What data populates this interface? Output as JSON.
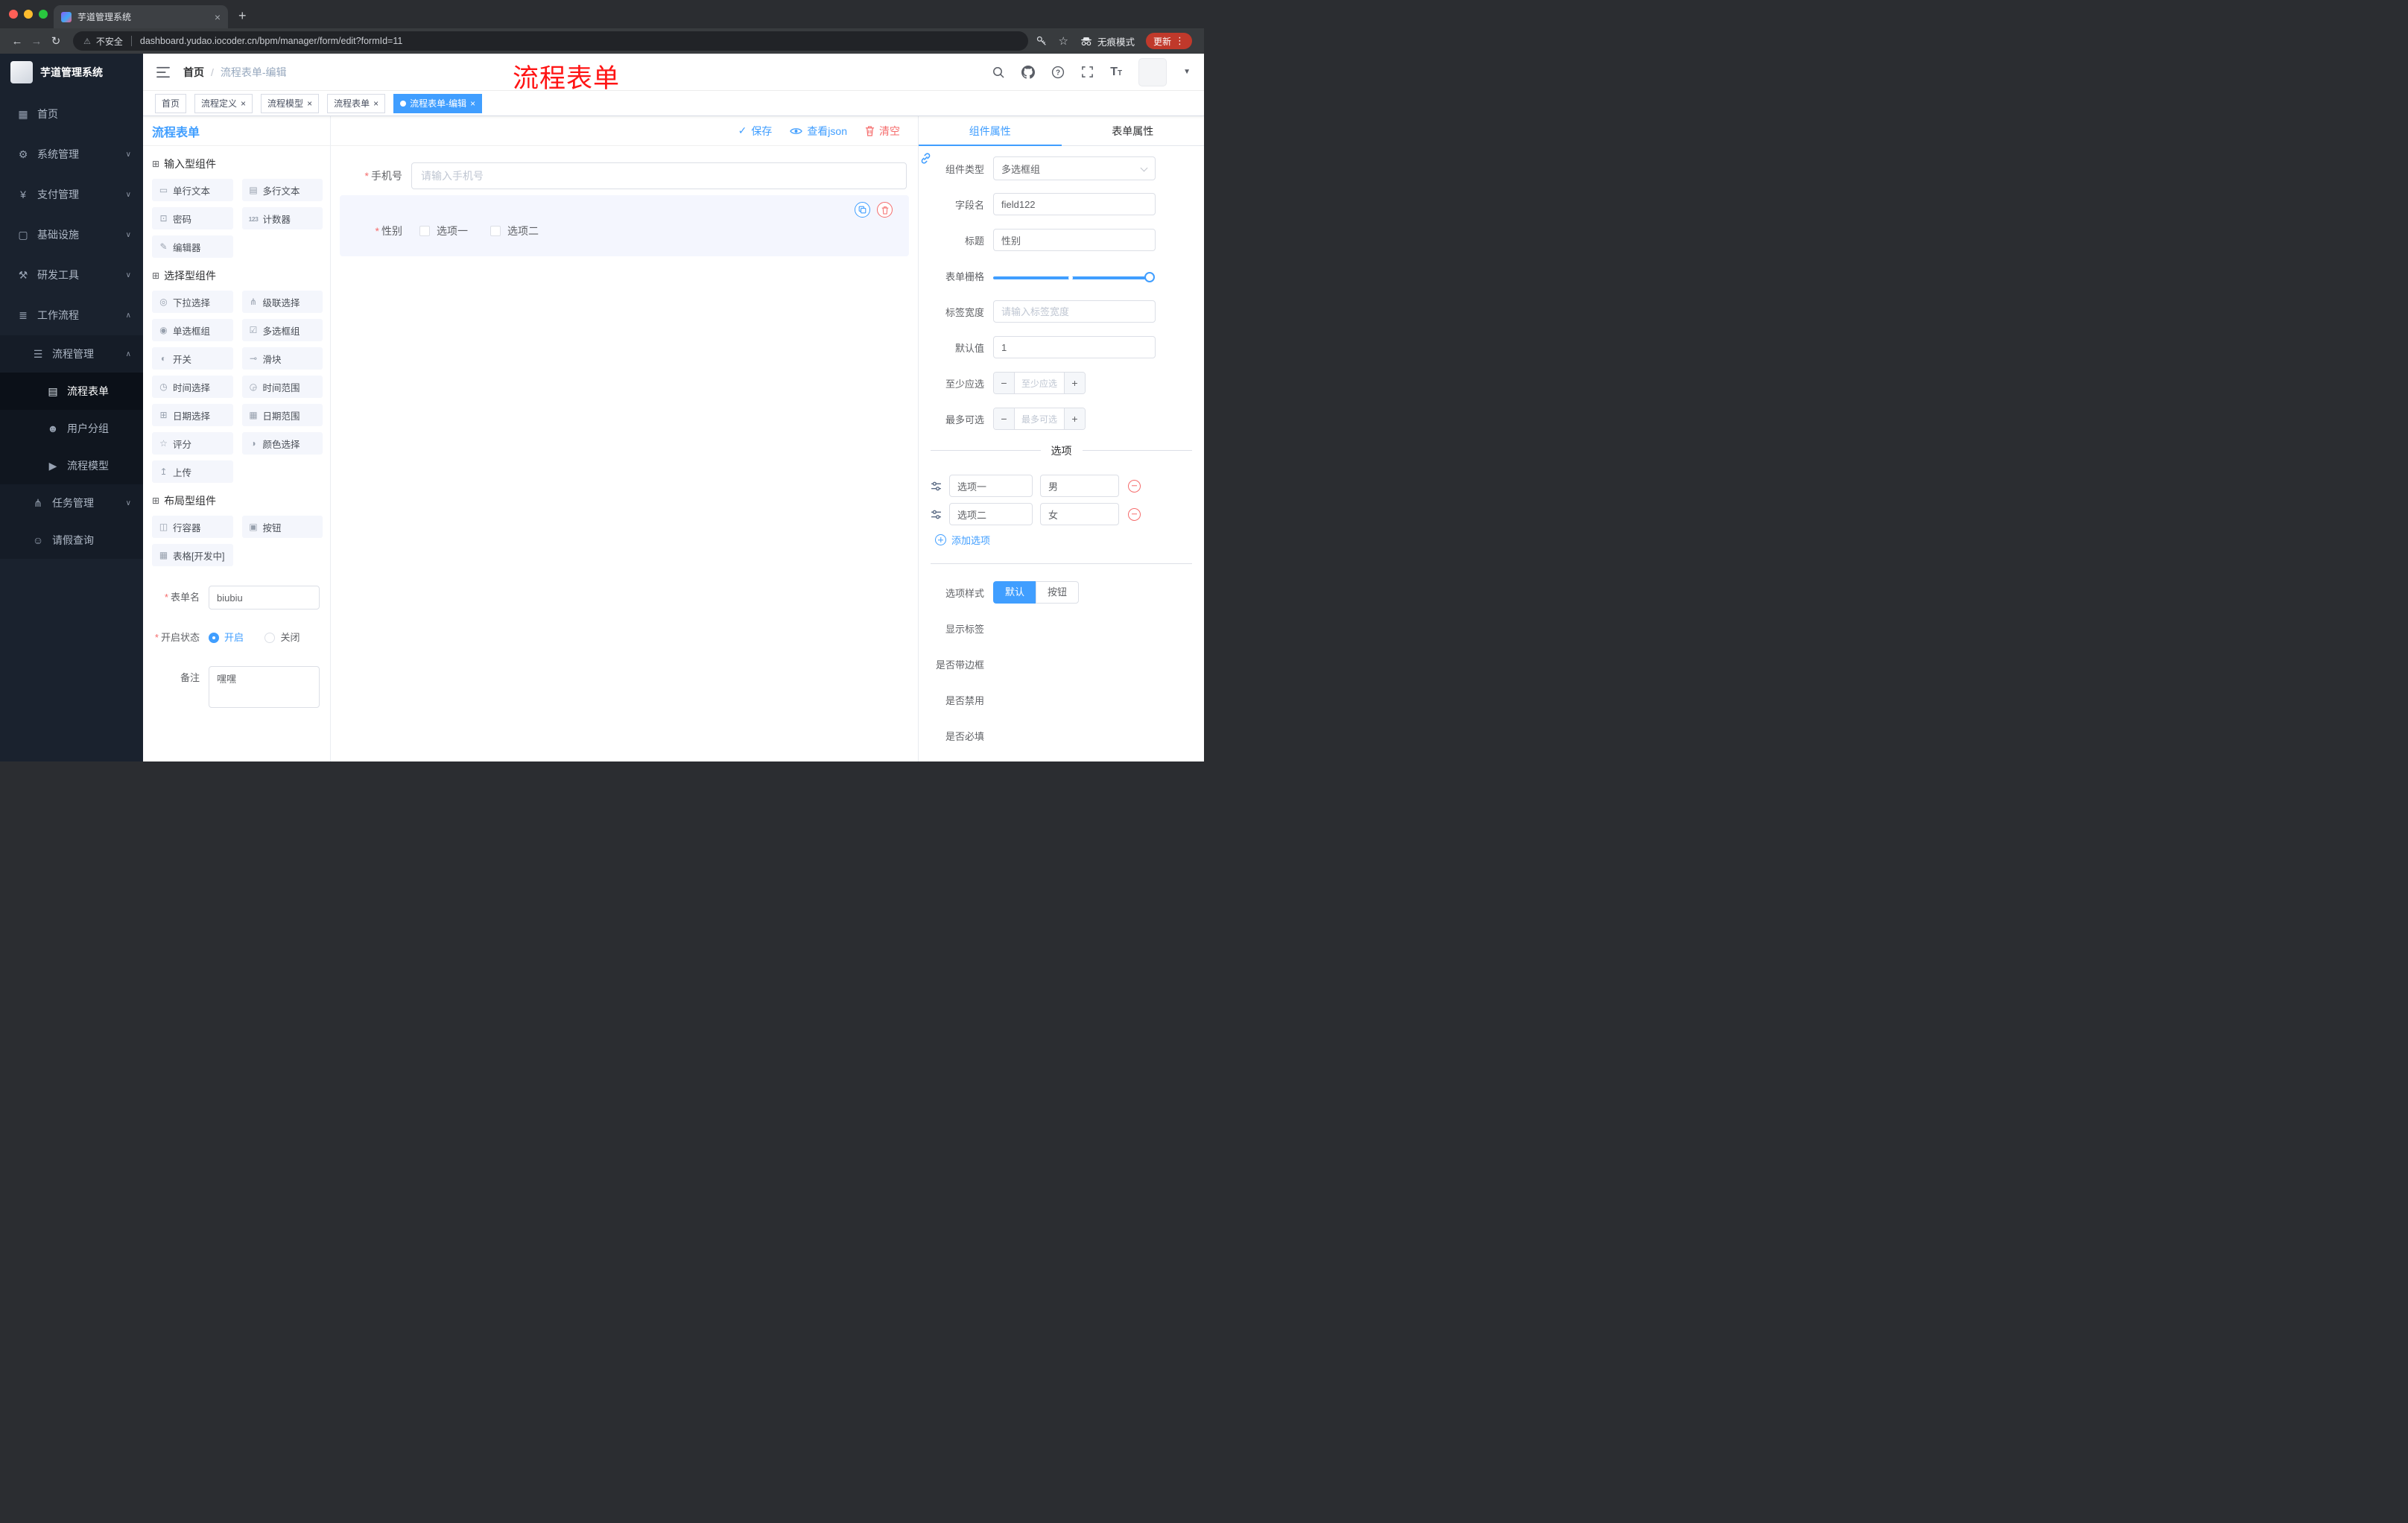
{
  "annotation": {
    "text": "流程表单"
  },
  "colors": {
    "primary": "#409EFF",
    "danger": "#F56C6C",
    "annotation_red": "#FF1414",
    "sidebar_bg": "#1A222E"
  },
  "browser": {
    "tab_title": "芋道管理系统",
    "security_label": "不安全",
    "url": "dashboard.yudao.iocoder.cn/bpm/manager/form/edit?formId=11",
    "incognito_label": "无痕模式",
    "update_label": "更新"
  },
  "sidebar": {
    "logo_title": "芋道管理系统",
    "items": [
      {
        "label": "首页",
        "icon": "dashboard-icon",
        "level": 1
      },
      {
        "label": "系统管理",
        "icon": "gear-icon",
        "level": 1,
        "chevron": "down"
      },
      {
        "label": "支付管理",
        "icon": "payment-icon",
        "level": 1,
        "chevron": "down"
      },
      {
        "label": "基础设施",
        "icon": "infrastructure-icon",
        "level": 1,
        "chevron": "down"
      },
      {
        "label": "研发工具",
        "icon": "dev-tools-icon",
        "level": 1,
        "chevron": "down"
      },
      {
        "label": "工作流程",
        "icon": "workflow-icon",
        "level": 1,
        "chevron": "up"
      },
      {
        "label": "流程管理",
        "icon": "process-manage-icon",
        "level": 2,
        "chevron": "up"
      },
      {
        "label": "流程表单",
        "icon": "process-form-icon",
        "level": 3,
        "active": true
      },
      {
        "label": "用户分组",
        "icon": "user-group-icon",
        "level": 3
      },
      {
        "label": "流程模型",
        "icon": "process-model-icon",
        "level": 3
      },
      {
        "label": "任务管理",
        "icon": "task-manage-icon",
        "level": 2,
        "chevron": "down"
      },
      {
        "label": "请假查询",
        "icon": "leave-query-icon",
        "level": 2
      }
    ]
  },
  "header": {
    "breadcrumb": {
      "home": "首页",
      "separator": "/",
      "current": "流程表单-编辑"
    },
    "icons": [
      "search-icon",
      "github-icon",
      "help-icon",
      "fullscreen-icon",
      "font-size-icon"
    ]
  },
  "tags": [
    {
      "label": "首页",
      "closable": false,
      "active": false
    },
    {
      "label": "流程定义",
      "closable": true,
      "active": false
    },
    {
      "label": "流程模型",
      "closable": true,
      "active": false
    },
    {
      "label": "流程表单",
      "closable": true,
      "active": false
    },
    {
      "label": "流程表单-编辑",
      "closable": true,
      "active": true
    }
  ],
  "designer": {
    "panel_title": "流程表单",
    "actions": {
      "save": "保存",
      "view_json": "查看json",
      "clear": "清空"
    },
    "palette": {
      "groups": [
        {
          "title": "输入型组件",
          "icon": "component-group-icon",
          "items": [
            {
              "label": "单行文本",
              "icon": "single-line-text-icon"
            },
            {
              "label": "多行文本",
              "icon": "multi-line-text-icon"
            },
            {
              "label": "密码",
              "icon": "password-icon"
            },
            {
              "label": "计数器",
              "icon": "counter-icon"
            },
            {
              "label": "编辑器",
              "icon": "editor-icon"
            }
          ]
        },
        {
          "title": "选择型组件",
          "icon": "component-group-icon",
          "items": [
            {
              "label": "下拉选择",
              "icon": "select-icon"
            },
            {
              "label": "级联选择",
              "icon": "cascader-icon"
            },
            {
              "label": "单选框组",
              "icon": "radio-group-icon"
            },
            {
              "label": "多选框组",
              "icon": "checkbox-group-icon"
            },
            {
              "label": "开关",
              "icon": "switch-icon"
            },
            {
              "label": "滑块",
              "icon": "slider-icon"
            },
            {
              "label": "时间选择",
              "icon": "time-picker-icon"
            },
            {
              "label": "时间范围",
              "icon": "time-range-icon"
            },
            {
              "label": "日期选择",
              "icon": "date-picker-icon"
            },
            {
              "label": "日期范围",
              "icon": "date-range-icon"
            },
            {
              "label": "评分",
              "icon": "rate-icon"
            },
            {
              "label": "颜色选择",
              "icon": "color-picker-icon"
            },
            {
              "label": "上传",
              "icon": "upload-icon"
            }
          ]
        },
        {
          "title": "布局型组件",
          "icon": "component-group-icon",
          "items": [
            {
              "label": "行容器",
              "icon": "row-container-icon"
            },
            {
              "label": "按钮",
              "icon": "button-icon"
            },
            {
              "label": "表格[开发中]",
              "icon": "table-icon"
            }
          ]
        }
      ]
    },
    "meta_form": {
      "name_label": "表单名",
      "name_value": "biubiu",
      "status_label": "开启状态",
      "status_on": "开启",
      "status_off": "关闭",
      "status_value": "开启",
      "remark_label": "备注",
      "remark_value": "嘿嘿"
    },
    "canvas": {
      "phone": {
        "label": "手机号",
        "required": true,
        "placeholder": "请输入手机号"
      },
      "gender": {
        "label": "性别",
        "required": true,
        "options": [
          "选项一",
          "选项二"
        ],
        "selected": true
      }
    }
  },
  "properties": {
    "tab_component": "组件属性",
    "tab_form": "表单属性",
    "active_tab": "组件属性",
    "component_type": {
      "label": "组件类型",
      "value": "多选框组"
    },
    "field_name": {
      "label": "字段名",
      "value": "field122"
    },
    "title": {
      "label": "标题",
      "value": "性别"
    },
    "grid": {
      "label": "表单栅格",
      "value": 24,
      "max": 24,
      "mark": 12
    },
    "label_width": {
      "label": "标签宽度",
      "placeholder": "请输入标签宽度"
    },
    "default_value": {
      "label": "默认值",
      "value": "1"
    },
    "min_select": {
      "label": "至少应选",
      "placeholder": "至少应选"
    },
    "max_select": {
      "label": "最多可选",
      "placeholder": "最多可选"
    },
    "options": {
      "divider": "选项",
      "rows": [
        {
          "name": "选项一",
          "value": "男"
        },
        {
          "name": "选项二",
          "value": "女"
        }
      ],
      "add_label": "添加选项"
    },
    "option_style": {
      "label": "选项样式",
      "options": [
        "默认",
        "按钮"
      ],
      "value": "默认"
    },
    "switches": [
      {
        "label": "显示标签",
        "on": true
      },
      {
        "label": "是否带边框",
        "on": false
      },
      {
        "label": "是否禁用",
        "on": false
      },
      {
        "label": "是否必填",
        "on": true
      }
    ]
  }
}
